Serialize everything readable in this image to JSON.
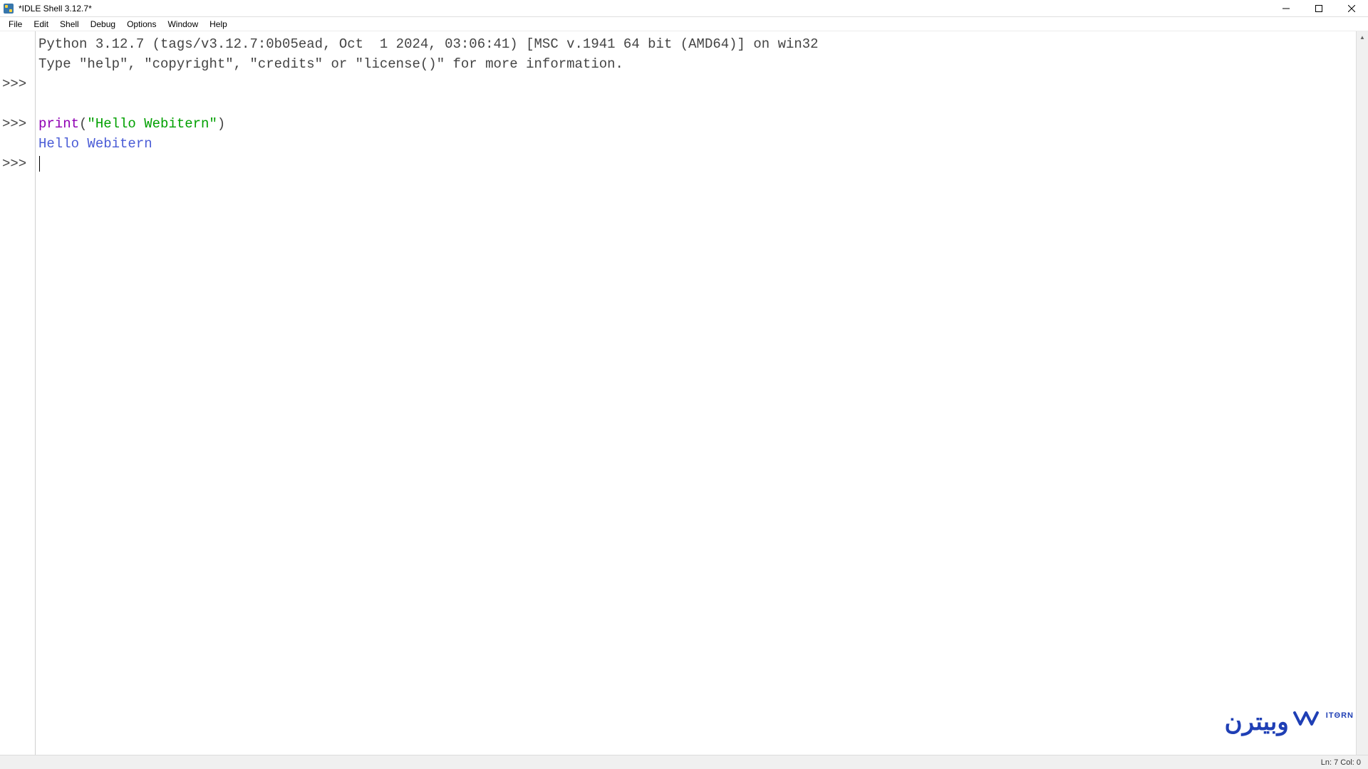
{
  "window": {
    "title": "*IDLE Shell 3.12.7*"
  },
  "menu": {
    "items": [
      "File",
      "Edit",
      "Shell",
      "Debug",
      "Options",
      "Window",
      "Help"
    ]
  },
  "shell": {
    "banner1": "Python 3.12.7 (tags/v3.12.7:0b05ead, Oct  1 2024, 03:06:41) [MSC v.1941 64 bit (AMD64)] on win32",
    "banner2": "Type \"help\", \"copyright\", \"credits\" or \"license()\" for more information.",
    "prompt": ">>>",
    "input_fn": "print",
    "input_paren_open": "(",
    "input_quote_open": "\"",
    "input_string": "Hello Webitern",
    "input_quote_close": "\"",
    "input_paren_close": ")",
    "output": "Hello Webitern"
  },
  "statusbar": {
    "text": "Ln: 7  Col: 0"
  },
  "watermark": {
    "arabic": "وبيترن",
    "english": "ITΘRN"
  }
}
